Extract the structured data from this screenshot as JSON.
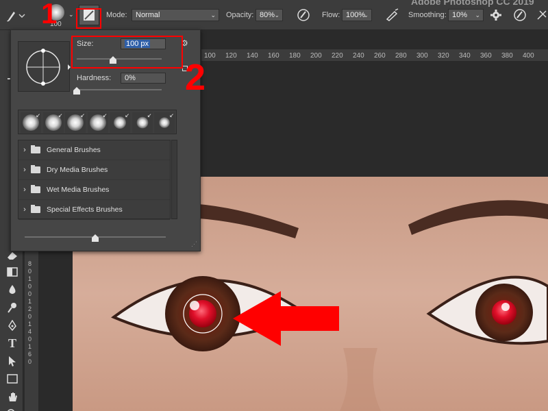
{
  "app": {
    "title": "Adobe Photoshop CC 2019"
  },
  "options_bar": {
    "brush_size_value": "100",
    "mode_label": "Mode:",
    "mode_value": "Normal",
    "opacity_label": "Opacity:",
    "opacity_value": "80%",
    "flow_label": "Flow:",
    "flow_value": "100%",
    "smoothing_label": "Smoothing:",
    "smoothing_value": "10%"
  },
  "brush_popup": {
    "size_label": "Size:",
    "size_value": "100 px",
    "size_slider_fraction": 0.43,
    "hardness_label": "Hardness:",
    "hardness_value": "0%",
    "hardness_slider_fraction": 0.0,
    "preview_slider_fraction": 0.5,
    "preset_count": 7,
    "folders": [
      {
        "label": "General Brushes"
      },
      {
        "label": "Dry Media Brushes"
      },
      {
        "label": "Wet Media Brushes"
      },
      {
        "label": "Special Effects Brushes"
      }
    ]
  },
  "ruler": {
    "top_ticks": [
      "100",
      "120",
      "140",
      "160",
      "180",
      "200",
      "220",
      "240",
      "260",
      "280",
      "300",
      "320",
      "340",
      "360",
      "380",
      "400"
    ],
    "left_ticks": [
      "8",
      "0",
      "1",
      "0",
      "0",
      "1",
      "2",
      "0",
      "1",
      "4",
      "0",
      "1",
      "6",
      "0"
    ]
  },
  "annotations": {
    "step1": "1",
    "step2": "2",
    "accent_color": "#ff0000"
  }
}
